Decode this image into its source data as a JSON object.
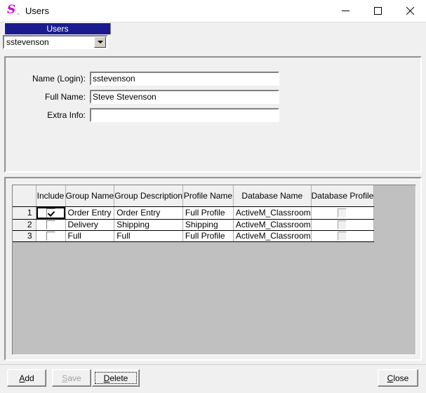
{
  "window": {
    "title": "Users",
    "icon": "app-s-icon",
    "controls": {
      "minimize": "minimize-icon",
      "maximize": "maximize-icon",
      "close": "close-icon"
    }
  },
  "tab": {
    "label": "Users"
  },
  "combo": {
    "value": "sstevenson",
    "arrow": "chevron-down-icon"
  },
  "form": {
    "fields": [
      {
        "label": "Name (Login):",
        "value": "sstevenson",
        "placeholder": ""
      },
      {
        "label": "Full Name:",
        "value": "Steve Stevenson",
        "placeholder": ""
      },
      {
        "label": "Extra Info:",
        "value": "",
        "placeholder": ""
      }
    ]
  },
  "grid": {
    "row_header": "",
    "columns": [
      "Include",
      "Group Name",
      "Group Description",
      "Profile Name",
      "Database Name",
      "Database Profile"
    ],
    "rows": [
      {
        "number": "1",
        "include": true,
        "include_selected": true,
        "group_name": "Order Entry",
        "group_description": "Order Entry",
        "profile_name": "Full Profile",
        "database_name": "ActiveM_Classroom",
        "database_profile": false
      },
      {
        "number": "2",
        "include": false,
        "include_selected": false,
        "group_name": "Delivery",
        "group_description": "Shipping",
        "profile_name": "Shipping",
        "database_name": "ActiveM_Classroom",
        "database_profile": false
      },
      {
        "number": "3",
        "include": false,
        "include_selected": false,
        "group_name": "Full",
        "group_description": "Full",
        "profile_name": "Full Profile",
        "database_name": "ActiveM_Classroom",
        "database_profile": false
      }
    ]
  },
  "buttons": {
    "add": {
      "mnemonic": "A",
      "rest": "dd"
    },
    "save": {
      "mnemonic": "S",
      "rest": "ave"
    },
    "delete": {
      "mnemonic": "D",
      "rest": "elete"
    },
    "close": {
      "mnemonic": "C",
      "rest": "lose"
    }
  },
  "colors": {
    "tab_background": "#1b1b8f",
    "tab_text": "#ffffff",
    "window_background": "#f0f0f0",
    "grid_filler": "#c0c0c0",
    "icon_accent": "#d100d1"
  }
}
